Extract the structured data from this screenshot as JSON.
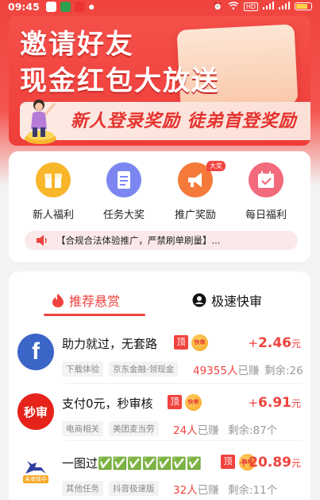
{
  "status_bar": {
    "time": "09:45",
    "hd": "HD"
  },
  "banner": {
    "title_line1": "邀请好友",
    "title_line2": "现金红包大放送",
    "subtitle": "新人登录奖励  徒弟首登奖励"
  },
  "quick_menu": [
    {
      "label": "新人福利",
      "icon": "gift-icon",
      "color": "#f8b62a"
    },
    {
      "label": "任务大奖",
      "icon": "task-list-icon",
      "color": "#7b86f0"
    },
    {
      "label": "推广奖励",
      "icon": "megaphone-icon",
      "color": "#f57a3a",
      "badge": "大奖"
    },
    {
      "label": "每日福利",
      "icon": "calendar-check-icon",
      "color": "#f26a7c"
    }
  ],
  "notice": "【合规合法体验推广，严禁刷单刷量】...",
  "tabs": {
    "active": "推荐悬赏",
    "inactive": "极速快审"
  },
  "tasks": [
    {
      "title": "助力就过，无套路",
      "top_badge": "顶",
      "fast_badge": "快审",
      "reward_plus": "+",
      "reward_amount": "2.46",
      "reward_unit": "元",
      "tags": [
        "下载体验",
        "京东金融-领现金"
      ],
      "earned_count": "49355人",
      "earned_suffix": "已赚",
      "remain": "剩余:26"
    },
    {
      "title": "支付0元，秒审核",
      "top_badge": "顶",
      "fast_badge": "快审",
      "logo_text": "秒审",
      "reward_plus": "+",
      "reward_amount": "6.91",
      "reward_unit": "元",
      "tags": [
        "电商相关",
        "美团麦当劳"
      ],
      "earned_count": "24人",
      "earned_suffix": "已赚",
      "remain": "剩余:87个"
    },
    {
      "title": "一图过✅✅✅✅✅✅✅",
      "top_badge": "顶",
      "fast_badge": "快审",
      "logo_text": "未审核中",
      "reward_plus": "+",
      "reward_amount": "20.89",
      "reward_unit": "元",
      "tags": [
        "其他任务",
        "抖音极速版"
      ],
      "earned_count": "32人",
      "earned_suffix": "已赚",
      "remain": "剩余:11个"
    }
  ],
  "colors": {
    "brand_red": "#f0433e",
    "gift": "#f8b62a",
    "task": "#7b86f0",
    "promo": "#f57a3a",
    "daily": "#f26a7c"
  }
}
